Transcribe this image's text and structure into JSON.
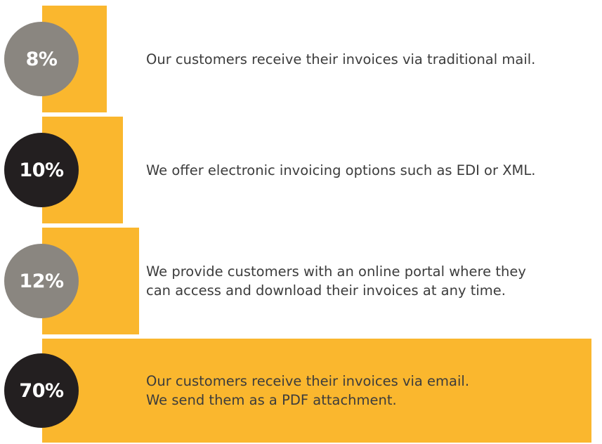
{
  "colors": {
    "bar": "#fab72e",
    "badge_gray": "#8a8680",
    "badge_dark": "#231f20",
    "text": "#3c3c3c"
  },
  "chart_data": {
    "type": "bar",
    "orientation": "horizontal",
    "unit": "%",
    "xlim": [
      0,
      100
    ],
    "categories": [
      "Our customers receive their invoices via traditional mail.",
      "We offer electronic invoicing options such as EDI or XML.",
      "We provide customers with an online portal where they can access and download their invoices at any time.",
      "Our customers receive their invoices via email. We send them as a PDF attachment."
    ],
    "values": [
      8,
      10,
      12,
      70
    ],
    "value_labels": [
      "8%",
      "10%",
      "12%",
      "70%"
    ],
    "description_lines": [
      [
        "Our customers receive their invoices via traditional mail."
      ],
      [
        "We offer electronic invoicing options such as EDI or XML."
      ],
      [
        "We provide customers with an online portal where they",
        "can access and download their invoices at any time."
      ],
      [
        "Our customers receive their invoices via email.",
        "We send them as a PDF attachment."
      ]
    ],
    "badge_tones": [
      "gray",
      "dark",
      "gray",
      "dark"
    ]
  }
}
